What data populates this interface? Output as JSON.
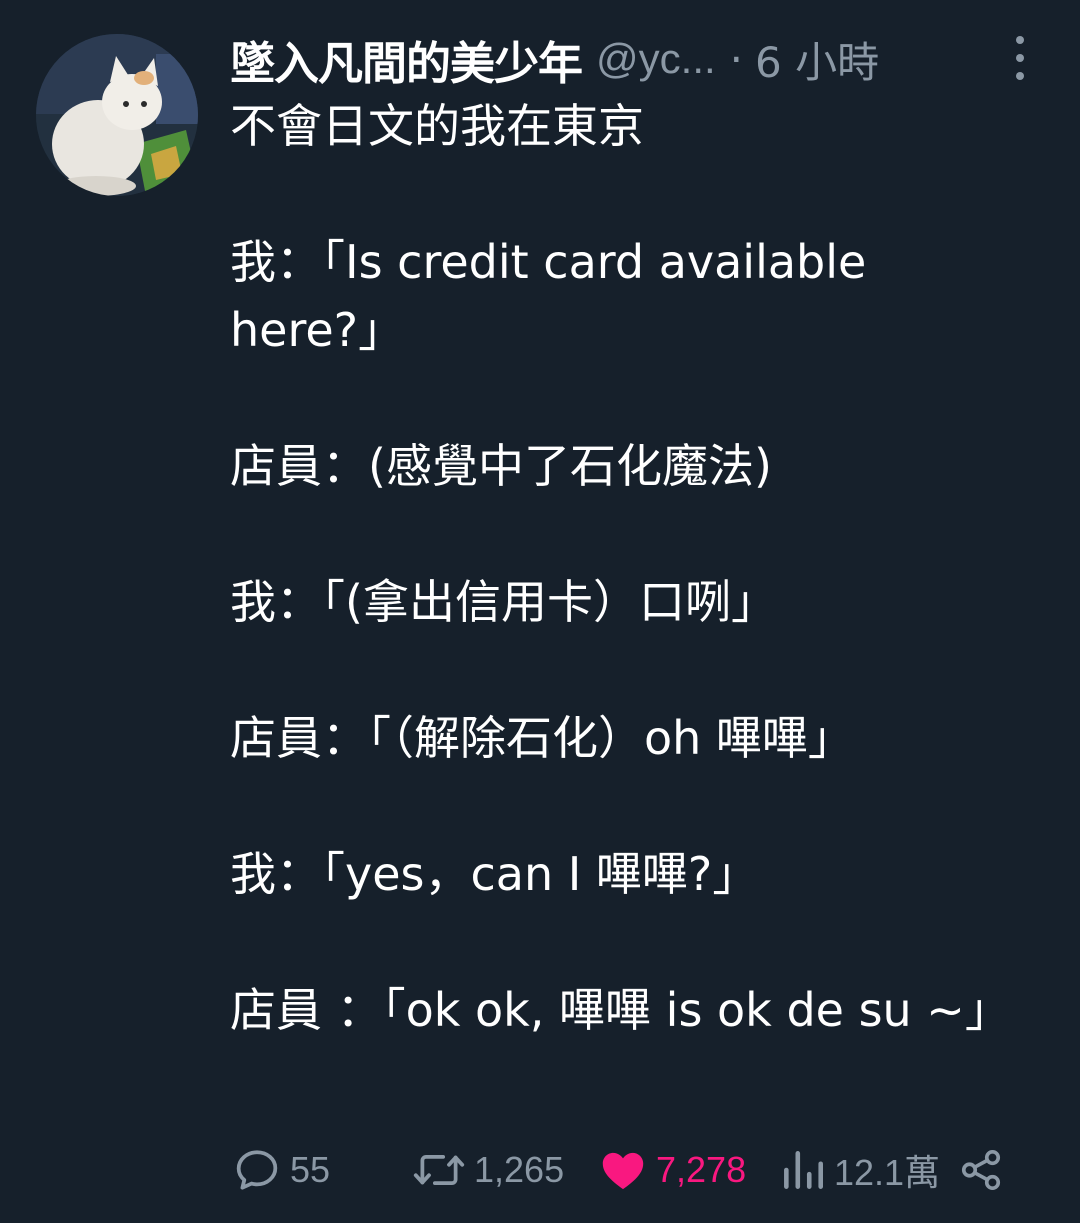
{
  "author": {
    "display_name": "墜入凡間的美少年",
    "handle": "@yc...",
    "separator": "·",
    "timestamp": "6 小時"
  },
  "tweet": {
    "lines": [
      "不會日文的我在東京",
      "",
      "我：「Is credit card available here?」",
      "",
      "店員：(感覺中了石化魔法)",
      "",
      "我：「(拿出信用卡）口咧」",
      "",
      "店員：「（解除石化）oh 嗶嗶」",
      "",
      "我：「yes，can I 嗶嗶?」",
      "",
      "店員 ：「ok ok, 嗶嗶 is ok de su ~」"
    ]
  },
  "actions": {
    "reply_count": "55",
    "repost_count": "1,265",
    "like_count": "7,278",
    "view_count": "12.1萬"
  },
  "colors": {
    "background": "#16202b",
    "text": "#ffffff",
    "muted": "#8b98a5",
    "like": "#f91880"
  },
  "icons": [
    "more-icon",
    "reply-icon",
    "repost-icon",
    "like-icon",
    "views-icon",
    "share-icon"
  ]
}
